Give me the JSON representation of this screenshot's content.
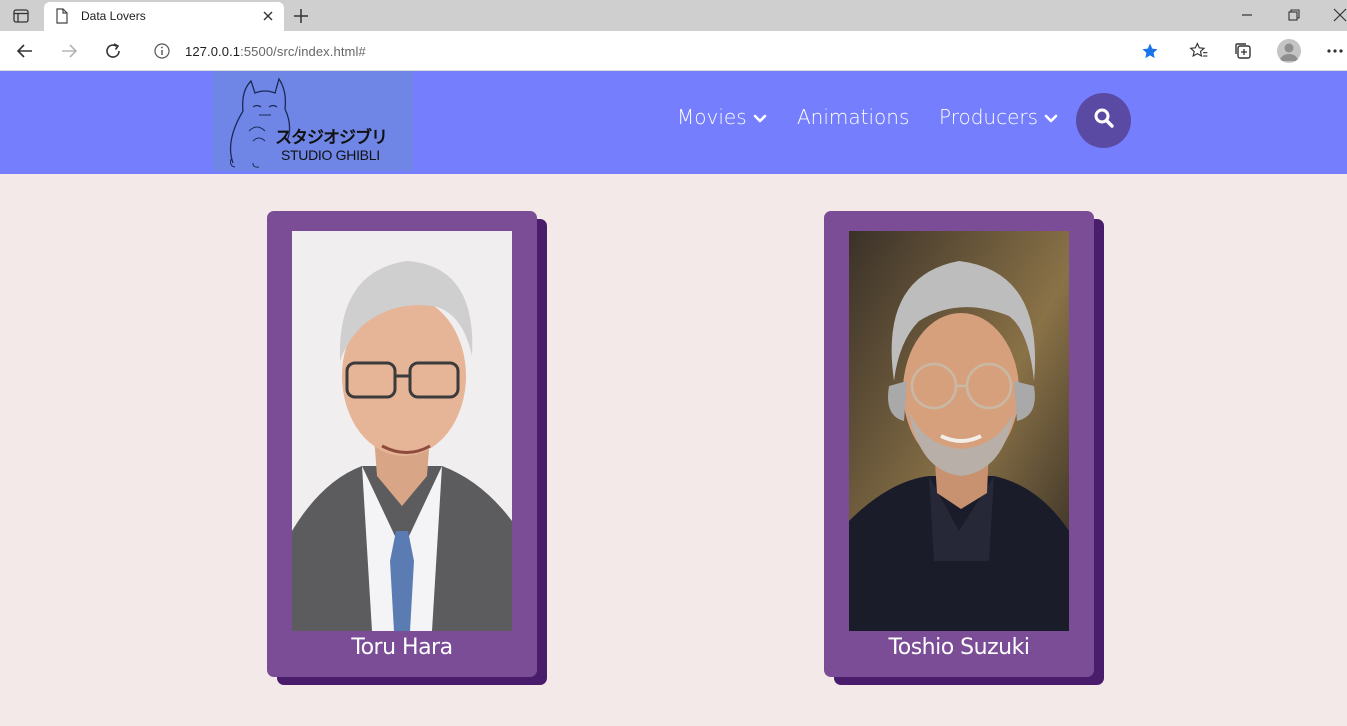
{
  "browser": {
    "tab_title": "Data Lovers",
    "url_host": "127.0.0.1",
    "url_rest": ":5500/src/index.html#",
    "star_color": "#1a73e8"
  },
  "site": {
    "logo_jp": "スタジオジブリ",
    "logo_en": "STUDIO GHIBLI",
    "nav": {
      "movies": "Movies",
      "animations": "Animations",
      "producers": "Producers"
    },
    "header_color": "#757efd",
    "search_color": "#5b4aa3"
  },
  "producers": [
    {
      "name": "Toru Hara"
    },
    {
      "name": "Toshio Suzuki"
    }
  ],
  "colors": {
    "page_bg": "#f3e9e9",
    "card": "#7a4d96",
    "card_shadow": "#4a1d6c"
  }
}
